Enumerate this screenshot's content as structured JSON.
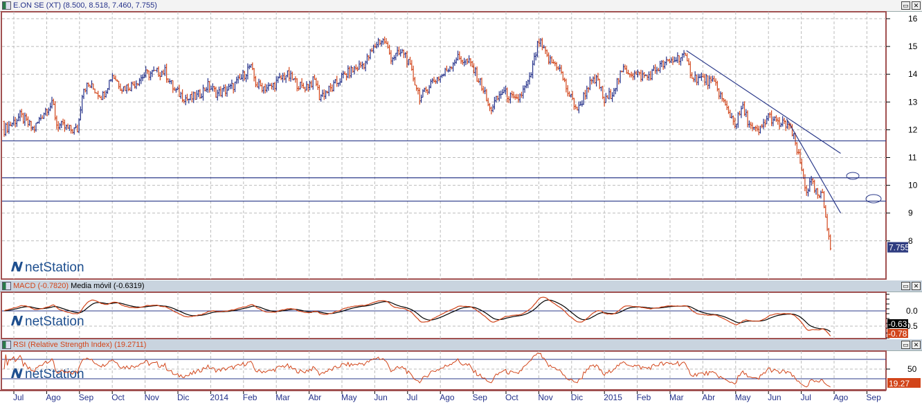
{
  "main_title": "E.ON SE (XT) (8.500, 8.518, 7.460, 7.755)",
  "macd_title": "MACD (-0.7820)",
  "macd_ma_title": "Media móvil (-0.6319)",
  "rsi_title": "RSI (Relative Strength Index) (19.2711)",
  "watermark": "netStation",
  "window_buttons": {
    "maximize": "▭",
    "close": "✕"
  },
  "colors": {
    "up": "#24318a",
    "down": "#d2451a",
    "frame": "#a05050",
    "line": "#2b3a8a"
  },
  "chart_data": [
    {
      "type": "ohlc",
      "title": "E.ON SE (XT)",
      "ylim": [
        7.2,
        16.4
      ],
      "yticks": [
        8,
        9,
        10,
        11,
        12,
        13,
        14,
        15,
        16
      ],
      "last_label": "7.755",
      "months": [
        "Jul",
        "Ago",
        "Sep",
        "Oct",
        "Nov",
        "Dic",
        "2014",
        "Feb",
        "Mar",
        "Abr",
        "May",
        "Jun",
        "Jul",
        "Ago",
        "Sep",
        "Oct",
        "Nov",
        "Dic",
        "2015",
        "Feb",
        "Mar",
        "Abr",
        "May",
        "Jun",
        "Jul",
        "Ago",
        "Sep"
      ],
      "close_path": [
        [
          0,
          12.3
        ],
        [
          0.2,
          12.5
        ],
        [
          0.6,
          12.0
        ],
        [
          1.0,
          12.8
        ],
        [
          1.2,
          12.9
        ],
        [
          1.3,
          12.2
        ],
        [
          1.7,
          12.0
        ],
        [
          1.95,
          12.0
        ],
        [
          2.1,
          13.5
        ],
        [
          2.3,
          13.6
        ],
        [
          2.7,
          13.2
        ],
        [
          3.0,
          14.0
        ],
        [
          3.3,
          13.5
        ],
        [
          3.6,
          13.6
        ],
        [
          4.0,
          14.0
        ],
        [
          4.6,
          14.1
        ],
        [
          4.9,
          13.4
        ],
        [
          5.3,
          13.1
        ],
        [
          5.6,
          13.2
        ],
        [
          5.9,
          13.6
        ],
        [
          6.2,
          13.3
        ],
        [
          6.6,
          13.5
        ],
        [
          6.9,
          13.8
        ],
        [
          7.2,
          14.3
        ],
        [
          7.4,
          13.6
        ],
        [
          7.8,
          13.5
        ],
        [
          8.3,
          14.0
        ],
        [
          8.8,
          13.5
        ],
        [
          9.2,
          13.8
        ],
        [
          9.3,
          13.2
        ],
        [
          9.7,
          13.5
        ],
        [
          10.0,
          13.9
        ],
        [
          10.4,
          14.2
        ],
        [
          10.7,
          14.4
        ],
        [
          11.1,
          15.2
        ],
        [
          11.3,
          15.2
        ],
        [
          11.5,
          14.6
        ],
        [
          11.9,
          14.8
        ],
        [
          12.2,
          13.8
        ],
        [
          12.4,
          13.1
        ],
        [
          12.7,
          13.7
        ],
        [
          13.1,
          14.0
        ],
        [
          13.5,
          14.6
        ],
        [
          13.9,
          14.4
        ],
        [
          14.3,
          13.5
        ],
        [
          14.5,
          12.7
        ],
        [
          14.9,
          13.4
        ],
        [
          15.3,
          13.0
        ],
        [
          15.7,
          13.7
        ],
        [
          16.0,
          15.2
        ],
        [
          16.3,
          14.5
        ],
        [
          16.6,
          14.3
        ],
        [
          16.9,
          13.3
        ],
        [
          17.2,
          12.7
        ],
        [
          17.5,
          13.6
        ],
        [
          17.8,
          13.8
        ],
        [
          18.0,
          13.0
        ],
        [
          18.2,
          13.3
        ],
        [
          18.6,
          14.2
        ],
        [
          18.9,
          14.0
        ],
        [
          19.3,
          13.9
        ],
        [
          19.7,
          14.3
        ],
        [
          20.1,
          14.5
        ],
        [
          20.4,
          14.7
        ],
        [
          20.7,
          13.9
        ],
        [
          21.1,
          13.8
        ],
        [
          21.4,
          13.6
        ],
        [
          21.7,
          12.8
        ],
        [
          22.0,
          12.2
        ],
        [
          22.2,
          12.8
        ],
        [
          22.5,
          12.0
        ],
        [
          22.7,
          11.9
        ],
        [
          23.0,
          12.5
        ],
        [
          23.3,
          12.2
        ],
        [
          23.6,
          12.2
        ],
        [
          23.8,
          11.6
        ],
        [
          24.0,
          10.6
        ],
        [
          24.15,
          9.8
        ],
        [
          24.3,
          10.1
        ],
        [
          24.5,
          9.6
        ],
        [
          24.65,
          9.6
        ],
        [
          24.75,
          8.8
        ],
        [
          24.85,
          8.2
        ],
        [
          24.9,
          7.755
        ]
      ],
      "hlines": [
        11.6,
        10.27,
        9.43
      ],
      "trendlines": [
        [
          [
            20.5,
            14.85
          ],
          [
            25.2,
            11.15
          ]
        ],
        [
          [
            23.55,
            12.4
          ],
          [
            25.2,
            9.0
          ]
        ]
      ]
    },
    {
      "type": "line",
      "title": "MACD",
      "series": [
        {
          "name": "MACD",
          "last": "-0.78"
        },
        {
          "name": "Media móvil",
          "last": "-0.63"
        }
      ],
      "yticks": [
        {
          "v": 0,
          "label": "0.0"
        },
        {
          "v": -0.5,
          "label": "0.5"
        }
      ],
      "ylim": [
        -0.92,
        0.6
      ]
    },
    {
      "type": "line",
      "title": "RSI",
      "last": "19.27",
      "yticks": [
        50
      ],
      "hlines": [
        70,
        30
      ],
      "ylim": [
        8,
        88
      ]
    }
  ]
}
